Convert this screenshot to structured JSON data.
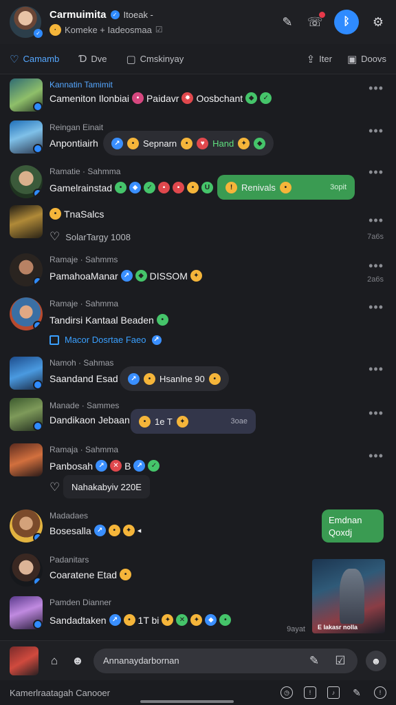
{
  "header": {
    "title": "Carmuimita",
    "title_sub": "Itoeak -",
    "status": "Komeke + Iadeosmaa",
    "icons": [
      "edit-icon",
      "phone-icon",
      "bluetooth-icon",
      "settings-icon"
    ]
  },
  "tabs": [
    {
      "label": "Camamb",
      "icon": "heart-icon",
      "active": true
    },
    {
      "label": "Dve",
      "icon": "d-icon",
      "active": false
    },
    {
      "label": "Cmskinyay",
      "icon": "square-icon",
      "active": false
    }
  ],
  "tabs_right": [
    {
      "label": "Iter",
      "icon": "upload-icon"
    },
    {
      "label": "Doovs",
      "icon": "device-icon"
    }
  ],
  "feed": [
    {
      "name": "Kannatin Tamimit",
      "text": "Cameniton Ilonbiai",
      "tail": "Paidavr",
      "tail2": "Oosbchant"
    },
    {
      "name": "Reingan Einait",
      "text": "Anpontiairh",
      "pill": "Sepnarn",
      "pill2": "Hand"
    },
    {
      "name": "Ramatie · Sahmma",
      "text": "Gamelrainstad",
      "pill": "Renivals",
      "time": "3opit"
    },
    {
      "name": "",
      "text": "TnaSalcs",
      "like": "SolarTargy 1008",
      "time": "7a6s"
    },
    {
      "name": "Ramaje · Sahmms",
      "text": "PamahoaManar",
      "tail": "DISSOM",
      "time": "2a6s"
    },
    {
      "name": "Ramaje · Sahmma",
      "text": "Tandirsi Kantaal Beaden",
      "link": "Macor Dosrtae Faeo"
    },
    {
      "name": "Namoh · Sahmas",
      "text": "Saandand Esad",
      "pill": "Hsanlne 90"
    },
    {
      "name": "Manade · Sammes",
      "text": "Dandikaon Jebaan",
      "pill": "1e T",
      "time": "3oae"
    },
    {
      "name": "Ramaja · Sahmma",
      "text": "Panbosah",
      "tail": "B",
      "like": "Nahakabyiv 220E"
    },
    {
      "name": "Madadaes",
      "text": "Bosesalla",
      "bubble": "Emdnan Qoxdj"
    },
    {
      "name": "Padanitars",
      "text": "Coaratene Etad"
    },
    {
      "name": "Pamden Dianner",
      "text": "Sandadtaken",
      "tail": "1T bi",
      "media_caption": "E Iakasr nolla",
      "media_time": "9ayat"
    }
  ],
  "composer": {
    "placeholder": "Annanaydarbornan"
  },
  "bottom": {
    "label": "Kamerlraatagah Canooer"
  }
}
